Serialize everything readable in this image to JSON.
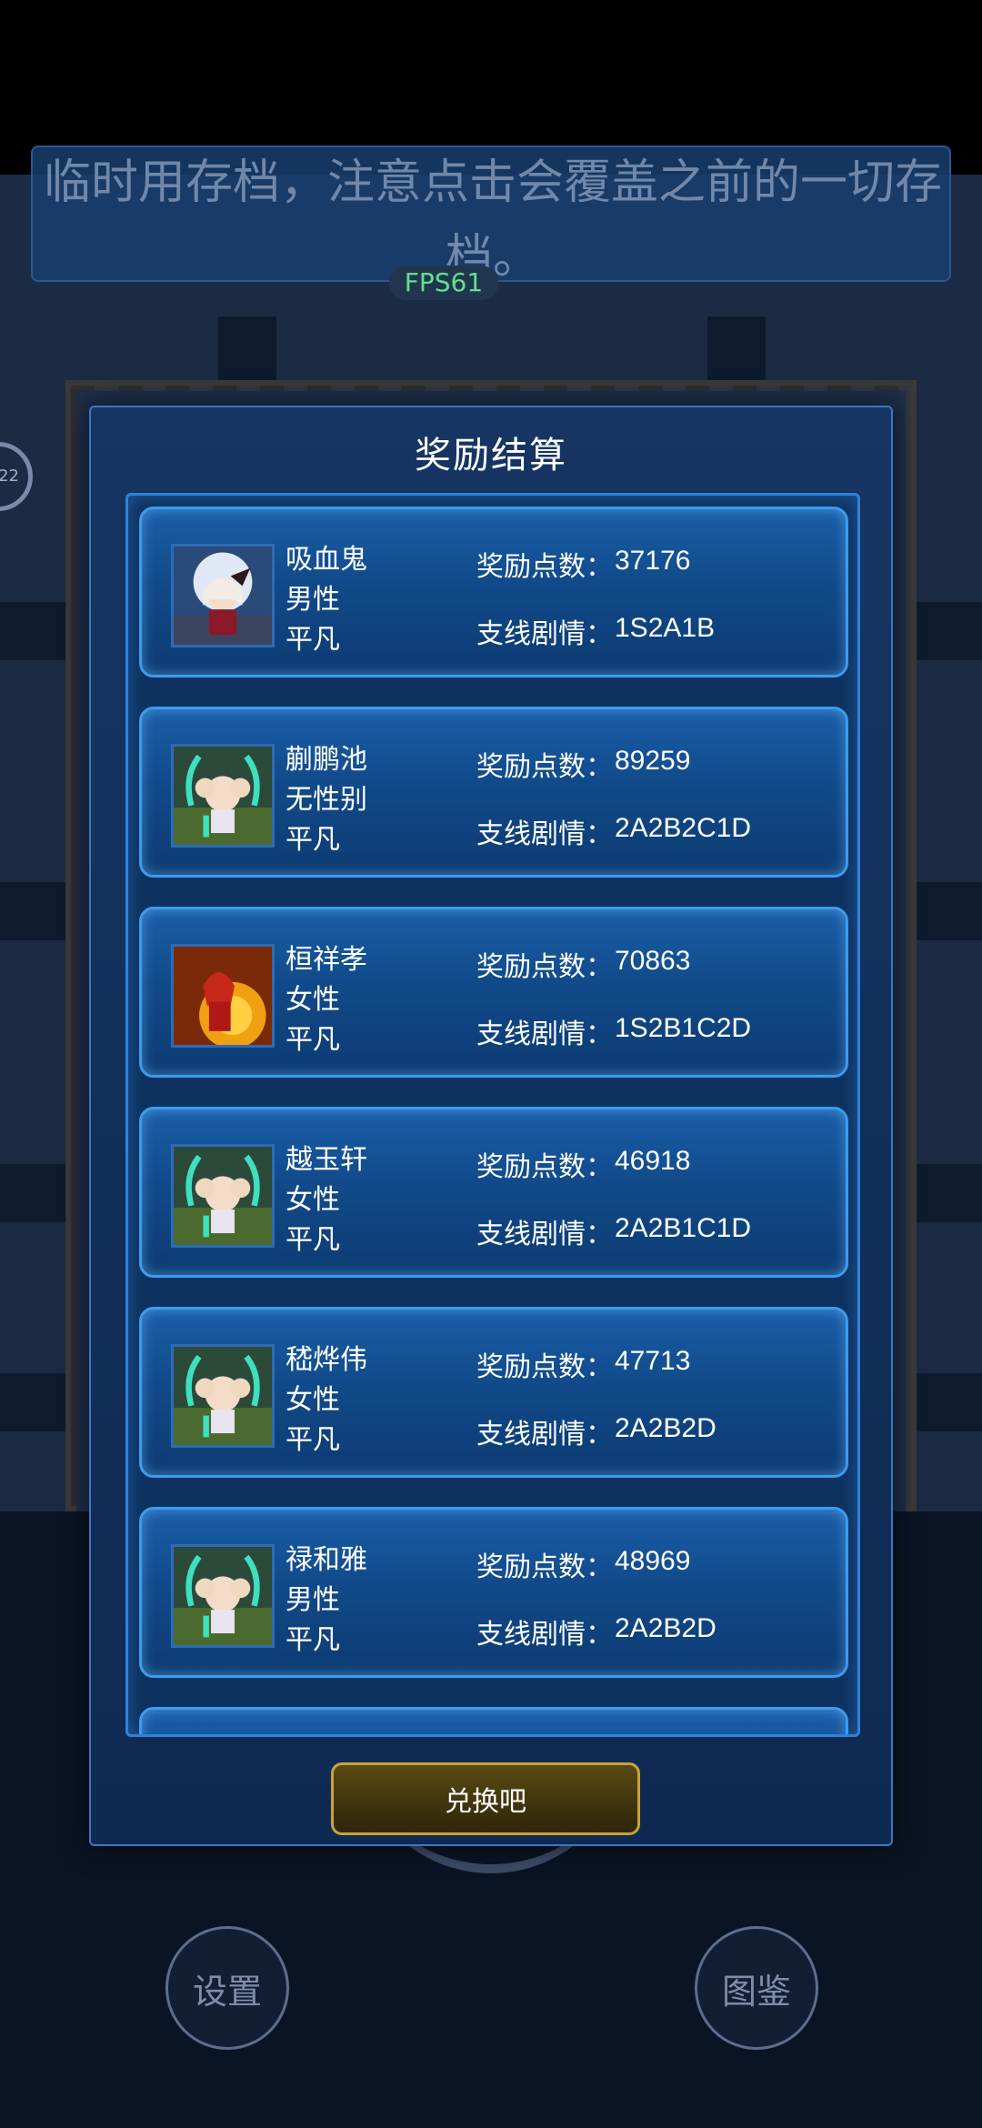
{
  "notice": {
    "text": "临时用存档，注意点击会覆盖之前的一切存档。"
  },
  "fps": "FPS61",
  "side_badge": "22",
  "modal": {
    "title": "奖励结算",
    "reward_label": "奖励点数：",
    "branch_label": "支线剧情：",
    "button": "兑换吧",
    "cards": [
      {
        "name": "吸血鬼",
        "gender": "男性",
        "talent": "平凡",
        "points": "37176",
        "branch": "1S2A1B",
        "avatar": "vampire-portrait"
      },
      {
        "name": "蒯鹏池",
        "gender": "无性别",
        "talent": "平凡",
        "points": "89259",
        "branch": "2A2B2C1D",
        "avatar": "sheep-girl-portrait"
      },
      {
        "name": "桓祥孝",
        "gender": "女性",
        "talent": "平凡",
        "points": "70863",
        "branch": "1S2B1C2D",
        "avatar": "fire-girl-portrait"
      },
      {
        "name": "越玉轩",
        "gender": "女性",
        "talent": "平凡",
        "points": "46918",
        "branch": "2A2B1C1D",
        "avatar": "sheep-girl-portrait"
      },
      {
        "name": "嵇烨伟",
        "gender": "女性",
        "talent": "平凡",
        "points": "47713",
        "branch": "2A2B2D",
        "avatar": "sheep-girl-portrait"
      },
      {
        "name": "禄和雅",
        "gender": "男性",
        "talent": "平凡",
        "points": "48969",
        "branch": "2A2B2D",
        "avatar": "sheep-girl-portrait"
      }
    ]
  },
  "bottom": {
    "settings": "设置",
    "codex": "图鉴"
  },
  "colors": {
    "modal_bg": "#163562",
    "card_border": "#3b9cf0",
    "button_border": "#c9a339",
    "fps_text": "#61e08c"
  }
}
